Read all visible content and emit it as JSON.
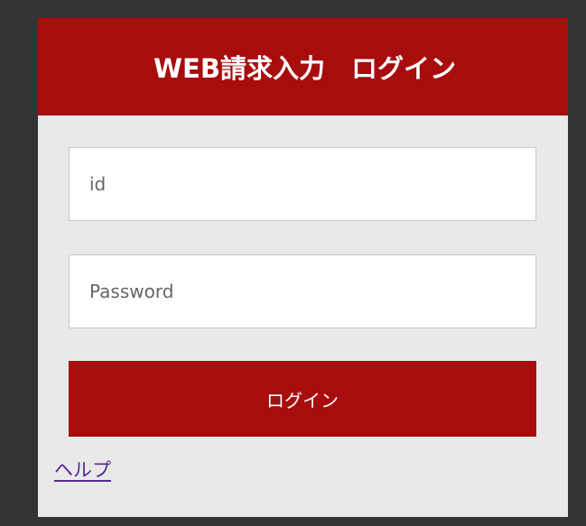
{
  "login": {
    "title": "WEB請求入力　ログイン",
    "id_placeholder": "id",
    "password_placeholder": "Password",
    "login_button_label": "ログイン",
    "help_link_label": "ヘルプ"
  },
  "colors": {
    "page_background": "#333333",
    "panel_background": "#e9e9e9",
    "brand_red": "#a80d0d",
    "field_border": "#c9c9c9",
    "link_purple": "#552b8f"
  }
}
